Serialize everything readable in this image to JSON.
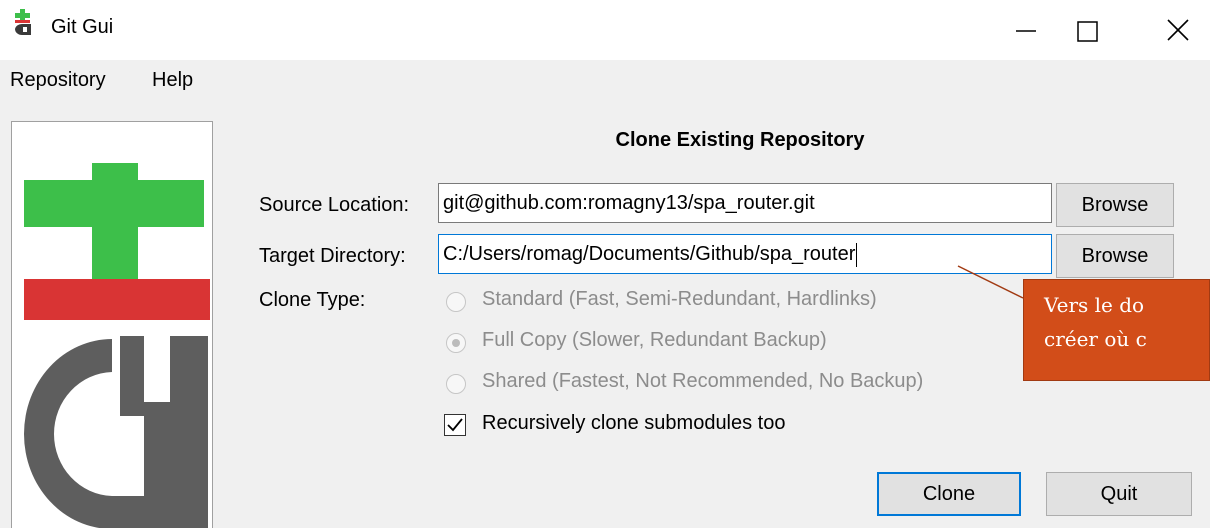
{
  "window": {
    "title": "Git Gui"
  },
  "menu": {
    "items": [
      "Repository",
      "Help"
    ]
  },
  "dialog": {
    "heading": "Clone Existing Repository",
    "source": {
      "label": "Source Location:",
      "value": "git@github.com:romagny13/spa_router.git",
      "browse_label": "Browse"
    },
    "target": {
      "label": "Target Directory:",
      "value": "C:/Users/romag/Documents/Github/spa_router",
      "browse_label": "Browse"
    },
    "clone_type": {
      "label": "Clone Type:",
      "options": [
        {
          "label": "Standard (Fast, Semi-Redundant, Hardlinks)",
          "selected": false
        },
        {
          "label": "Full Copy (Slower, Redundant Backup)",
          "selected": true
        },
        {
          "label": "Shared (Fastest, Not Recommended, No Backup)",
          "selected": false
        }
      ],
      "disabled": true
    },
    "recursive": {
      "label": "Recursively clone submodules too",
      "checked": true
    },
    "clone_label": "Clone",
    "quit_label": "Quit"
  },
  "callout": {
    "line1": "Vers le do",
    "line2": "créer où c"
  },
  "colors": {
    "logo_green": "#3dbf4a",
    "logo_red": "#d93434",
    "logo_gray": "#5e5e5e",
    "callout_fill": "#d24d19",
    "focus_blue": "#0078d7"
  }
}
